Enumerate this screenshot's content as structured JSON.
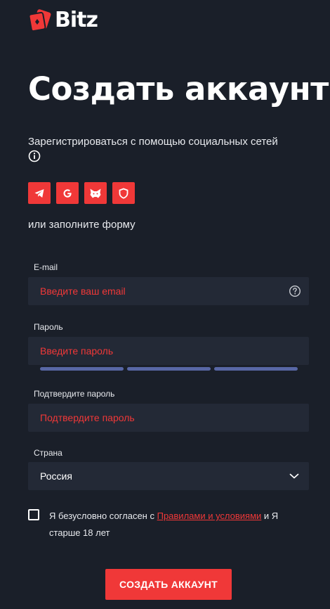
{
  "brand": {
    "name": "Bitz",
    "accent": "#f03838",
    "background": "#1a1f29",
    "field_bg": "#232936",
    "strength_color": "#5867a5"
  },
  "page": {
    "title": "Создать аккаунт"
  },
  "social": {
    "label": "Зарегистрироваться с помощью социальных сетей",
    "info_icon": "info-icon",
    "buttons": [
      {
        "icon": "telegram-icon"
      },
      {
        "icon": "google-icon"
      },
      {
        "icon": "metamask-fox-icon"
      },
      {
        "icon": "shield-icon"
      }
    ]
  },
  "form": {
    "or_label": "или заполните форму",
    "email": {
      "label": "E-mail",
      "placeholder": "Введите ваш email",
      "help_icon": "question-icon"
    },
    "password": {
      "label": "Пароль",
      "placeholder": "Введите пароль",
      "strength_segments": 3
    },
    "confirm": {
      "label": "Подтвердите пароль",
      "placeholder": "Подтвердите пароль"
    },
    "country": {
      "label": "Страна",
      "value": "Россия",
      "icon": "chevron-down-icon"
    },
    "agree": {
      "prefix": "Я безусловно согласен с ",
      "link": "Правилами и условиями",
      "suffix": " и Я старше 18 лет",
      "checked": false
    },
    "submit_label": "СОЗДАТЬ АККАУНТ"
  }
}
